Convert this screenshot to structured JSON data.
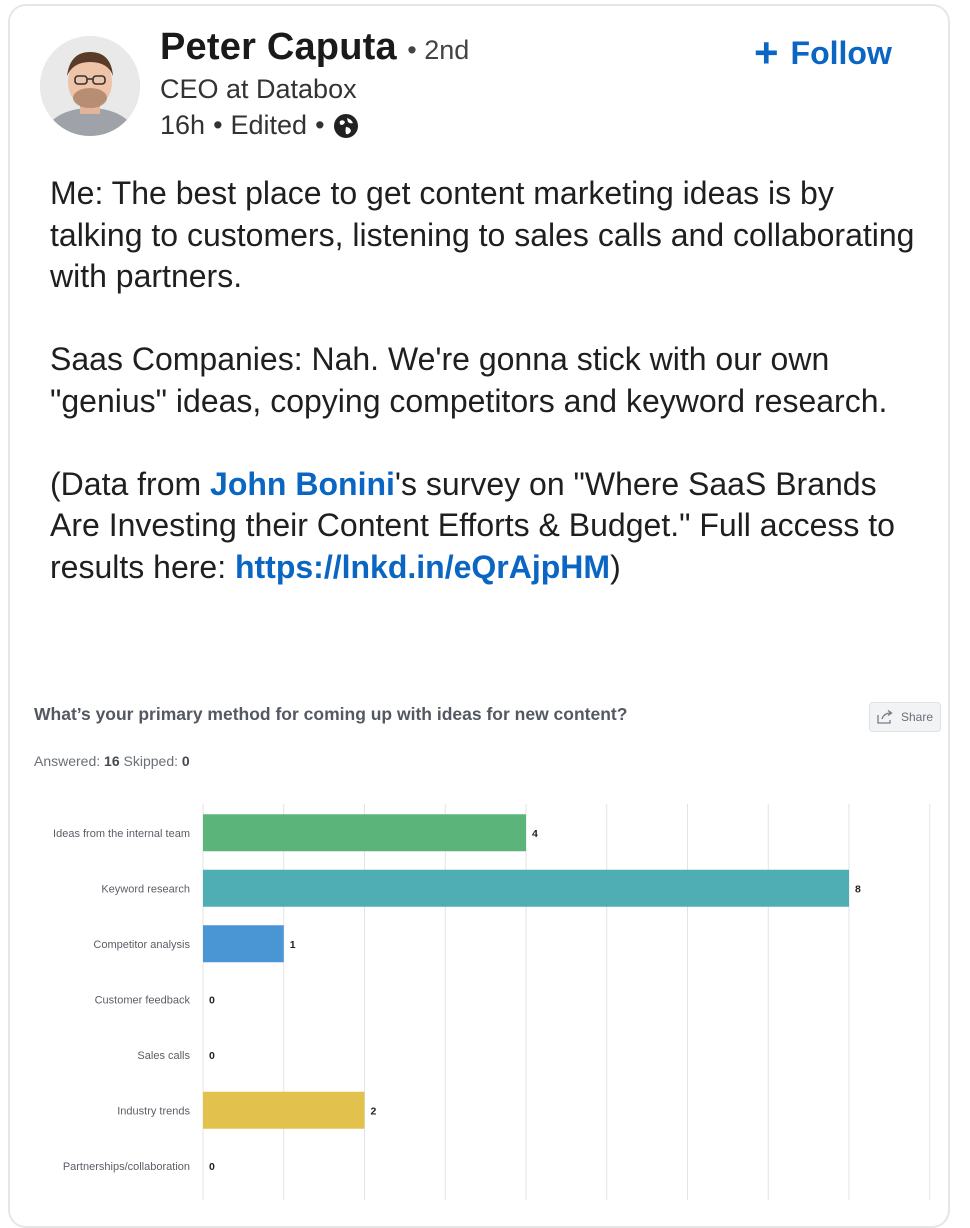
{
  "post": {
    "author": "Peter Caputa",
    "degree": "• 2nd",
    "headline": "CEO at Databox",
    "time": "16h",
    "edited": "Edited",
    "follow_label": "Follow",
    "text": {
      "p1": "Me: The best place to get content marketing ideas is by talking to customers, listening to sales calls and collaborating with partners.",
      "p2": "Saas Companies: Nah. We're gonna stick with our own \"genius\" ideas, copying competitors and keyword research.",
      "p3_prefix": "(Data from ",
      "p3_mention": "John Bonini",
      "p3_middle": "'s survey on \"Where SaaS Brands Are Investing their Content Efforts & Budget.\" Full access to results here:  ",
      "p3_link": "https://lnkd.in/eQrAjpHM",
      "p3_suffix": ")"
    }
  },
  "survey": {
    "question": "What’s your primary method for coming up with ideas for new content?",
    "share_label": "Share",
    "answered_label": "Answered:",
    "answered_value": "16",
    "skipped_label": "Skipped:",
    "skipped_value": "0"
  },
  "chart_data": {
    "type": "bar",
    "orientation": "horizontal",
    "categories": [
      "Ideas from the internal team",
      "Keyword research",
      "Competitor analysis",
      "Customer feedback",
      "Sales calls",
      "Industry trends",
      "Partnerships/collaboration"
    ],
    "values": [
      4,
      8,
      1,
      0,
      0,
      2,
      0
    ],
    "colors": [
      "#5bb57a",
      "#4fadb4",
      "#4a95d3",
      "#4a95d3",
      "#4a95d3",
      "#e2c14d",
      "#e2c14d"
    ],
    "xlim": [
      0,
      9
    ],
    "grid": true,
    "title": "",
    "xlabel": "",
    "ylabel": ""
  },
  "icons": {
    "globe": "globe-icon",
    "share": "share-icon",
    "follow": "plus-icon"
  },
  "colors": {
    "link": "#0a66c2",
    "grid": "#e3e3e3"
  }
}
